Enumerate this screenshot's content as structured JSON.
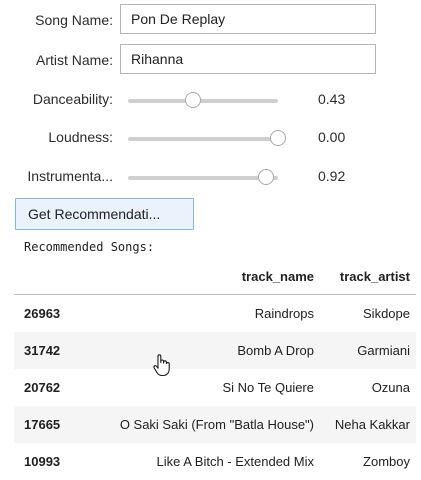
{
  "form": {
    "song_name_label": "Song Name:",
    "song_name_value": "Pon De Replay",
    "artist_name_label": "Artist Name:",
    "artist_name_value": "Rihanna"
  },
  "sliders": [
    {
      "label": "Danceability:",
      "value_text": "0.43",
      "level": 0.43
    },
    {
      "label": "Loudness:",
      "value_text": "0.00",
      "level": 1.0
    },
    {
      "label": "Instrumenta...",
      "value_text": "0.92",
      "level": 0.92
    }
  ],
  "button": {
    "label": "Get Recommendati..."
  },
  "output": {
    "heading": "Recommended Songs:"
  },
  "table": {
    "columns": [
      "",
      "track_name",
      "track_artist"
    ],
    "rows": [
      {
        "index": "26963",
        "track_name": "Raindrops",
        "track_artist": "Sikdope"
      },
      {
        "index": "31742",
        "track_name": "Bomb A Drop",
        "track_artist": "Garmiani"
      },
      {
        "index": "20762",
        "track_name": "Si No Te Quiere",
        "track_artist": "Ozuna"
      },
      {
        "index": "17665",
        "track_name": "O Saki Saki (From \"Batla House\")",
        "track_artist": "Neha Kakkar"
      },
      {
        "index": "10993",
        "track_name": "Like A Bitch - Extended Mix",
        "track_artist": "Zomboy"
      }
    ]
  },
  "icons": {
    "cursor": "hand-pointer-icon"
  }
}
